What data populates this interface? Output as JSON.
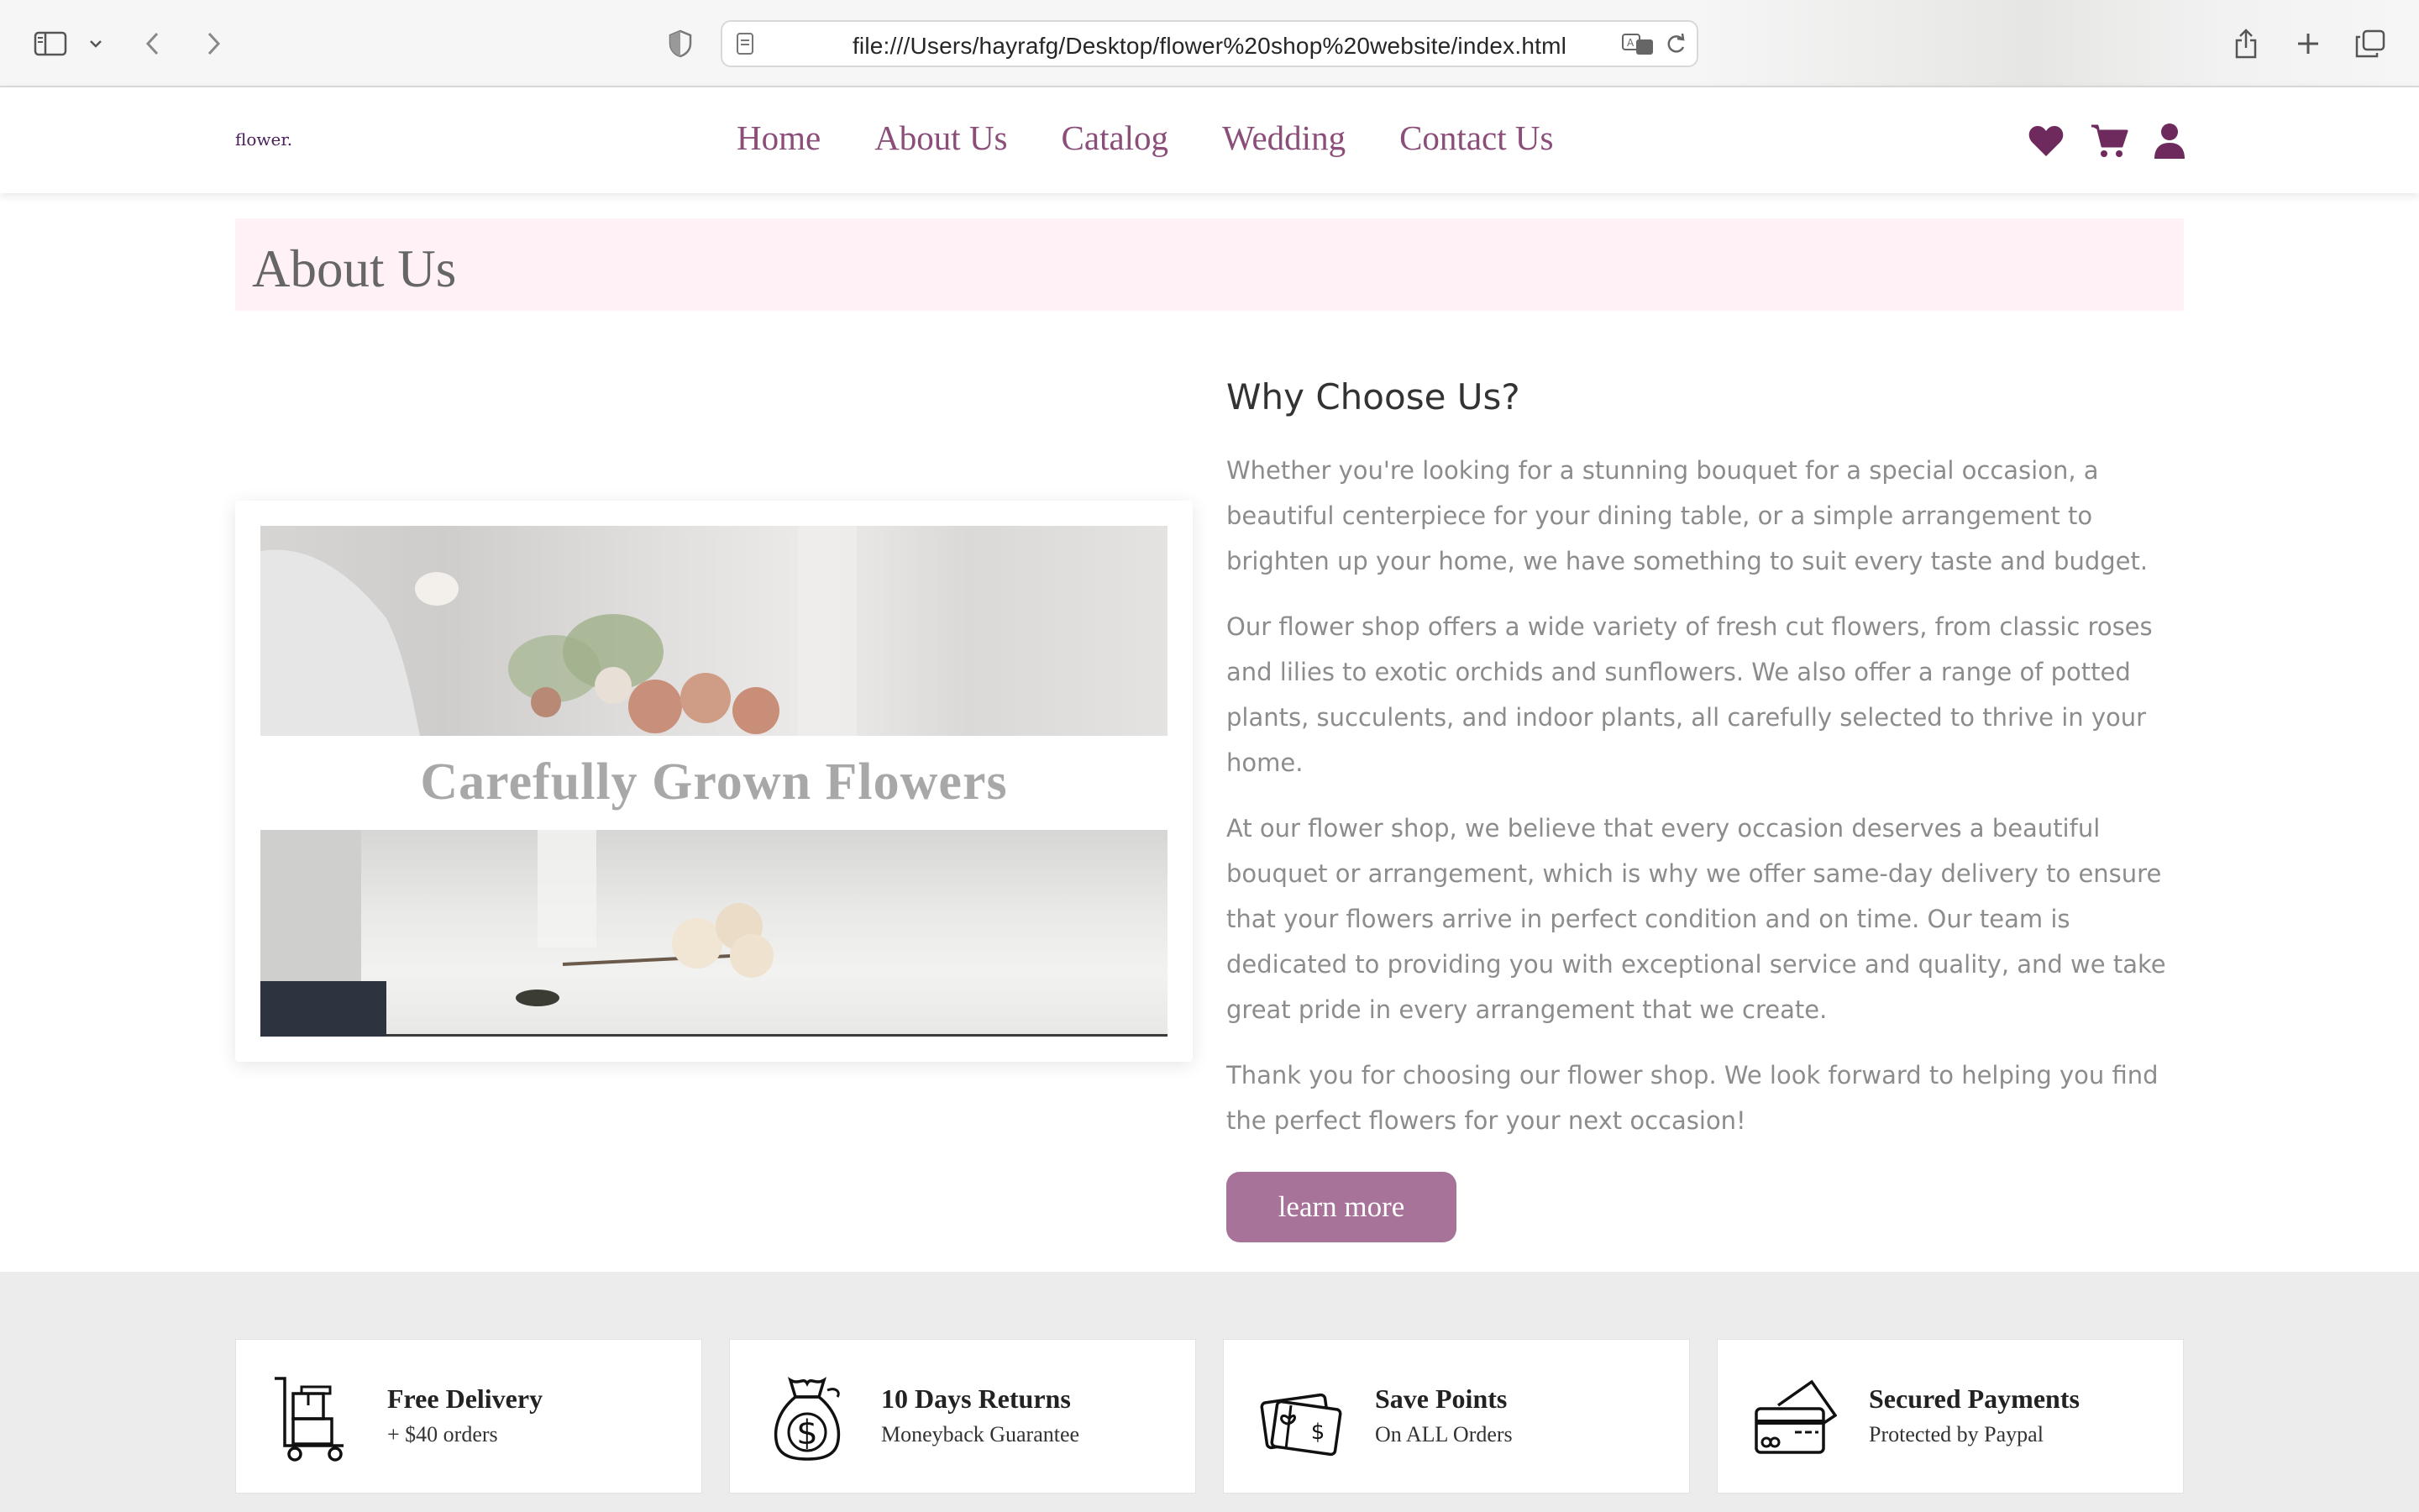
{
  "browser": {
    "url": "file:///Users/hayrafg/Desktop/flower%20shop%20website/index.html",
    "icons": [
      "sidebar-icon",
      "chevron-down-icon",
      "back-icon",
      "forward-icon",
      "shield-icon",
      "page-icon",
      "translate-icon",
      "reload-icon",
      "share-icon",
      "plus-icon",
      "tabs-icon"
    ]
  },
  "site": {
    "logo": "flower.",
    "nav": [
      "Home",
      "About Us",
      "Catalog",
      "Wedding",
      "Contact Us"
    ],
    "header_icons": [
      "heart-icon",
      "cart-icon",
      "user-icon"
    ],
    "accent_color": "#8a4e79"
  },
  "about": {
    "heading": "About Us",
    "video_caption": "Carefully Grown Flowers",
    "title": "Why Choose Us?",
    "paragraphs": [
      "Whether you're looking for a stunning bouquet for a special occasion, a beautiful centerpiece for your dining table, or a simple arrangement to brighten up your home, we have something to suit every taste and budget.",
      "Our flower shop offers a wide variety of fresh cut flowers, from classic roses and lilies to exotic orchids and sunflowers. We also offer a range of potted plants, succulents, and indoor plants, all carefully selected to thrive in your home.",
      "At our flower shop, we believe that every occasion deserves a beautiful bouquet or arrangement, which is why we offer same-day delivery to ensure that your flowers arrive in perfect condition and on time. Our team is dedicated to providing you with exceptional service and quality, and we take great pride in every arrangement that we create.",
      "Thank you for choosing our flower shop. We look forward to helping you find the perfect flowers for your next occasion!"
    ],
    "button": "learn more",
    "button_color": "#a77399"
  },
  "features": [
    {
      "icon": "delivery-cart-icon",
      "title": "Free Delivery",
      "subtitle": "+ $40 orders"
    },
    {
      "icon": "money-bag-icon",
      "title": "10 Days Returns",
      "subtitle": "Moneyback Guarantee"
    },
    {
      "icon": "gift-card-icon",
      "title": "Save Points",
      "subtitle": "On ALL Orders"
    },
    {
      "icon": "credit-card-icon",
      "title": "Secured Payments",
      "subtitle": "Protected by Paypal"
    }
  ]
}
